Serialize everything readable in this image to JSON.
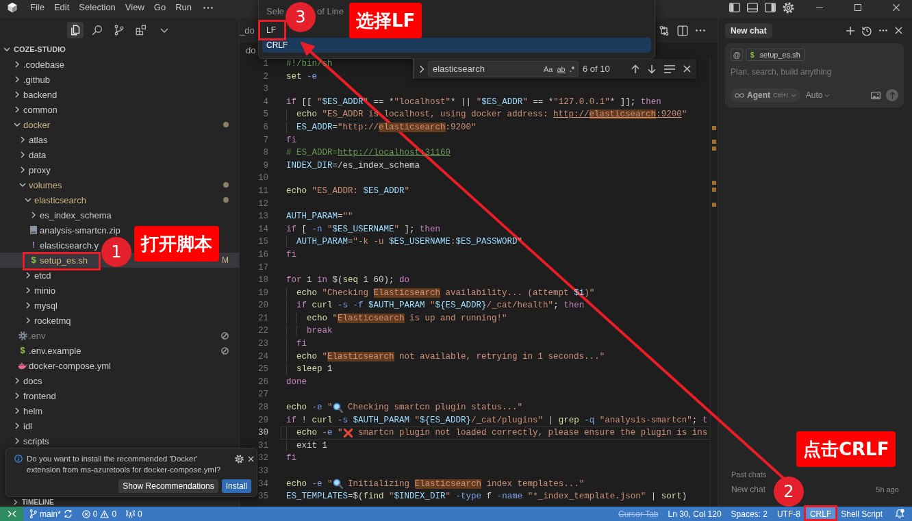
{
  "window": {
    "menu": [
      "File",
      "Edit",
      "Selection",
      "View",
      "Go",
      "Run"
    ]
  },
  "activity_tabs": [
    {
      "selected": true
    },
    {
      "selected": false
    },
    {
      "selected": false
    },
    {
      "selected": false
    }
  ],
  "explorer": {
    "root": {
      "label": "COZE-STUDIO",
      "expanded": true
    },
    "items": [
      {
        "label": ".codebase",
        "kind": "folder",
        "expanded": false,
        "selected": false,
        "modified": false
      },
      {
        "label": ".github",
        "kind": "folder",
        "expanded": false,
        "selected": false,
        "modified": false
      },
      {
        "label": "backend",
        "kind": "folder",
        "expanded": false,
        "selected": false,
        "modified": false
      },
      {
        "label": "common",
        "kind": "folder",
        "expanded": false,
        "selected": false,
        "modified": false
      },
      {
        "label": "docker",
        "kind": "folder",
        "expanded": true,
        "selected": false,
        "modified": true,
        "children": [
          {
            "label": "atlas",
            "kind": "folder",
            "expanded": false,
            "selected": false,
            "modified": false
          },
          {
            "label": "data",
            "kind": "folder",
            "expanded": false,
            "selected": false,
            "modified": false
          },
          {
            "label": "proxy",
            "kind": "folder",
            "expanded": false,
            "selected": false,
            "modified": false
          },
          {
            "label": "volumes",
            "kind": "folder",
            "expanded": true,
            "selected": false,
            "modified": true,
            "children": [
              {
                "label": "elasticsearch",
                "kind": "folder",
                "expanded": true,
                "selected": false,
                "modified": true,
                "children": [
                  {
                    "label": "es_index_schema",
                    "kind": "folder",
                    "expanded": false,
                    "selected": false,
                    "modified": false
                  },
                  {
                    "label": "analysis-smartcn.zip",
                    "kind": "archive",
                    "selected": false,
                    "modified": false
                  },
                  {
                    "label": "elasticsearch.y",
                    "kind": "yaml",
                    "glyph": "!",
                    "selected": false,
                    "modified": false
                  },
                  {
                    "label": "setup_es.sh",
                    "kind": "shell",
                    "glyph": "$",
                    "selected": true,
                    "modified": true,
                    "badge": "M"
                  }
                ]
              },
              {
                "label": "etcd",
                "kind": "folder",
                "expanded": false,
                "selected": false,
                "modified": false
              },
              {
                "label": "minio",
                "kind": "folder",
                "expanded": false,
                "selected": false,
                "modified": false
              },
              {
                "label": "mysql",
                "kind": "folder",
                "expanded": false,
                "selected": false,
                "modified": false
              },
              {
                "label": "rocketmq",
                "kind": "folder",
                "expanded": false,
                "selected": false,
                "modified": false
              }
            ]
          },
          {
            "label": ".env",
            "kind": "settings",
            "selected": false,
            "modified": false,
            "dimmed": true,
            "blocked": true
          },
          {
            "label": ".env.example",
            "kind": "shell",
            "glyph": "$",
            "selected": false,
            "modified": false,
            "blocked": true
          },
          {
            "label": "docker-compose.yml",
            "kind": "docker",
            "selected": false,
            "modified": false
          }
        ]
      },
      {
        "label": "docs",
        "kind": "folder",
        "expanded": false,
        "selected": false,
        "modified": false
      },
      {
        "label": "frontend",
        "kind": "folder",
        "expanded": false,
        "selected": false,
        "modified": false
      },
      {
        "label": "helm",
        "kind": "folder",
        "expanded": false,
        "selected": false,
        "modified": false
      },
      {
        "label": "idl",
        "kind": "folder",
        "expanded": false,
        "selected": false,
        "modified": false
      },
      {
        "label": "scripts",
        "kind": "folder",
        "expanded": false,
        "selected": false,
        "modified": false
      }
    ]
  },
  "timeline": {
    "label": "TIMELINE",
    "expanded": false
  },
  "editor": {
    "tab": "_do",
    "breadcrumb": "do",
    "lines": [
      {
        "number": "1",
        "current": false,
        "segments": [
          {
            "text": "#!/bin/sh",
            "kind": "com"
          }
        ]
      },
      {
        "number": "2",
        "current": false,
        "segments": [
          {
            "text": "set",
            "kind": "fn"
          },
          {
            "text": " -e",
            "kind": "flag"
          }
        ]
      },
      {
        "number": "3",
        "current": false
      },
      {
        "number": "4",
        "current": false,
        "segments": [
          {
            "text": "if",
            "kind": "kw"
          },
          {
            "text": " [[ ",
            "kind": "plain"
          },
          {
            "text": "\"",
            "kind": "str"
          },
          {
            "text": "$ES_ADDR",
            "kind": "var"
          },
          {
            "text": "\"",
            "kind": "str"
          },
          {
            "text": " == *",
            "kind": "plain"
          },
          {
            "text": "\"localhost\"",
            "kind": "str"
          },
          {
            "text": "* || ",
            "kind": "plain"
          },
          {
            "text": "\"",
            "kind": "str"
          },
          {
            "text": "$ES_ADDR",
            "kind": "var"
          },
          {
            "text": "\"",
            "kind": "str"
          },
          {
            "text": " == *",
            "kind": "plain"
          },
          {
            "text": "\"127.0.0.1\"",
            "kind": "str"
          },
          {
            "text": "* ]]; ",
            "kind": "plain"
          },
          {
            "text": "then",
            "kind": "kw"
          }
        ]
      },
      {
        "number": "5",
        "current": false,
        "segments": [
          {
            "text": "  echo",
            "kind": "fn"
          },
          {
            "text": " \"ES_ADDR is localhost, using docker address: ",
            "kind": "str"
          },
          {
            "text": "http://",
            "kind": "link"
          },
          {
            "text": "elasticsearch",
            "kind": "match-link"
          },
          {
            "text": ":9200",
            "kind": "link"
          },
          {
            "text": "\"",
            "kind": "str"
          }
        ]
      },
      {
        "number": "6",
        "current": false,
        "segments": [
          {
            "text": "  ES_ADDR",
            "kind": "var"
          },
          {
            "text": "=",
            "kind": "plain"
          },
          {
            "text": "\"http://",
            "kind": "str"
          },
          {
            "text": "elasticsearch",
            "kind": "match"
          },
          {
            "text": ":9200\"",
            "kind": "str"
          }
        ]
      },
      {
        "number": "7",
        "current": false,
        "segments": [
          {
            "text": "fi",
            "kind": "kw"
          }
        ]
      },
      {
        "number": "8",
        "current": false,
        "segments": [
          {
            "text": "# ES_ADDR=",
            "kind": "com"
          },
          {
            "text": "http://localhost:31160",
            "kind": "com-link"
          }
        ]
      },
      {
        "number": "9",
        "current": false,
        "segments": [
          {
            "text": "INDEX_DIR",
            "kind": "var"
          },
          {
            "text": "=/es_index_schema",
            "kind": "plain"
          }
        ]
      },
      {
        "number": "10",
        "current": false
      },
      {
        "number": "11",
        "current": false,
        "segments": [
          {
            "text": "echo",
            "kind": "fn"
          },
          {
            "text": " \"ES_ADDR: ",
            "kind": "str"
          },
          {
            "text": "$ES_ADDR",
            "kind": "var"
          },
          {
            "text": "\"",
            "kind": "str"
          }
        ]
      },
      {
        "number": "12",
        "current": false
      },
      {
        "number": "13",
        "current": false,
        "segments": [
          {
            "text": "AUTH_PARAM",
            "kind": "var"
          },
          {
            "text": "=",
            "kind": "plain"
          },
          {
            "text": "\"\"",
            "kind": "str"
          }
        ]
      },
      {
        "number": "14",
        "current": false,
        "segments": [
          {
            "text": "if",
            "kind": "kw"
          },
          {
            "text": " [ ",
            "kind": "plain"
          },
          {
            "text": "-n",
            "kind": "flag"
          },
          {
            "text": " \"",
            "kind": "str"
          },
          {
            "text": "$ES_USERNAME",
            "kind": "var"
          },
          {
            "text": "\"",
            "kind": "str"
          },
          {
            "text": " ]; ",
            "kind": "plain"
          },
          {
            "text": "then",
            "kind": "kw"
          }
        ]
      },
      {
        "number": "15",
        "current": false,
        "segments": [
          {
            "text": "  AUTH_PARAM",
            "kind": "var"
          },
          {
            "text": "=",
            "kind": "plain"
          },
          {
            "text": "\"-k -u ",
            "kind": "str"
          },
          {
            "text": "$ES_USERNAME",
            "kind": "var"
          },
          {
            "text": ":",
            "kind": "str"
          },
          {
            "text": "$ES_PASSWORD",
            "kind": "var"
          },
          {
            "text": "\"",
            "kind": "str"
          }
        ]
      },
      {
        "number": "16",
        "current": false,
        "segments": [
          {
            "text": "fi",
            "kind": "kw"
          }
        ]
      },
      {
        "number": "17",
        "current": false
      },
      {
        "number": "18",
        "current": false,
        "segments": [
          {
            "text": "for",
            "kind": "kw"
          },
          {
            "text": " i ",
            "kind": "plain"
          },
          {
            "text": "in",
            "kind": "kw"
          },
          {
            "text": " $(",
            "kind": "plain"
          },
          {
            "text": "seq",
            "kind": "fn"
          },
          {
            "text": " 1 60); ",
            "kind": "plain"
          },
          {
            "text": "do",
            "kind": "kw"
          }
        ]
      },
      {
        "number": "19",
        "current": false,
        "segments": [
          {
            "text": "  echo",
            "kind": "fn"
          },
          {
            "text": " \"Checking ",
            "kind": "str"
          },
          {
            "text": "Elasticsearch",
            "kind": "match"
          },
          {
            "text": " availability... (attempt ",
            "kind": "str"
          },
          {
            "text": "$i",
            "kind": "var"
          },
          {
            "text": ")\"",
            "kind": "str"
          }
        ]
      },
      {
        "number": "20",
        "current": false,
        "segments": [
          {
            "text": "  if",
            "kind": "kw"
          },
          {
            "text": " curl",
            "kind": "fn"
          },
          {
            "text": " -s -f ",
            "kind": "flag"
          },
          {
            "text": "$AUTH_PARAM",
            "kind": "var"
          },
          {
            "text": " \"",
            "kind": "str"
          },
          {
            "text": "${ES_ADDR}",
            "kind": "var"
          },
          {
            "text": "/_cat/health\"",
            "kind": "str"
          },
          {
            "text": "; ",
            "kind": "plain"
          },
          {
            "text": "then",
            "kind": "kw"
          }
        ]
      },
      {
        "number": "21",
        "current": false,
        "segments": [
          {
            "text": "    echo",
            "kind": "fn"
          },
          {
            "text": " \"",
            "kind": "str"
          },
          {
            "text": "Elasticsearch",
            "kind": "match"
          },
          {
            "text": " is up and running!\"",
            "kind": "str"
          }
        ]
      },
      {
        "number": "22",
        "current": false,
        "segments": [
          {
            "text": "    break",
            "kind": "kw"
          }
        ]
      },
      {
        "number": "23",
        "current": false,
        "segments": [
          {
            "text": "  fi",
            "kind": "kw"
          }
        ]
      },
      {
        "number": "24",
        "current": false,
        "segments": [
          {
            "text": "  echo",
            "kind": "fn"
          },
          {
            "text": " \"",
            "kind": "str"
          },
          {
            "text": "Elasticsearch",
            "kind": "match"
          },
          {
            "text": " not available, retrying in 1 seconds...\"",
            "kind": "str"
          }
        ]
      },
      {
        "number": "25",
        "current": false,
        "segments": [
          {
            "text": "  sleep",
            "kind": "fn"
          },
          {
            "text": " 1",
            "kind": "plain"
          }
        ]
      },
      {
        "number": "26",
        "current": false,
        "segments": [
          {
            "text": "done",
            "kind": "kw"
          }
        ]
      },
      {
        "number": "27",
        "current": false
      },
      {
        "number": "28",
        "current": false,
        "segments": [
          {
            "text": "echo",
            "kind": "fn"
          },
          {
            "text": " -e",
            "kind": "flag"
          },
          {
            "text": " \"",
            "kind": "str"
          },
          {
            "kind": "emoji-search"
          },
          {
            "text": " Checking smartcn plugin status...\"",
            "kind": "str"
          }
        ]
      },
      {
        "number": "29",
        "current": false,
        "segments": [
          {
            "text": "if",
            "kind": "kw"
          },
          {
            "text": " ! ",
            "kind": "plain"
          },
          {
            "text": "curl",
            "kind": "fn"
          },
          {
            "text": " -s ",
            "kind": "flag"
          },
          {
            "text": "$AUTH_PARAM",
            "kind": "var"
          },
          {
            "text": " \"",
            "kind": "str"
          },
          {
            "text": "${ES_ADDR}",
            "kind": "var"
          },
          {
            "text": "/_cat/plugins\"",
            "kind": "str"
          },
          {
            "text": " | ",
            "kind": "plain"
          },
          {
            "text": "grep",
            "kind": "fn"
          },
          {
            "text": " -q ",
            "kind": "flag"
          },
          {
            "text": "\"analysis-smartcn\"",
            "kind": "str"
          },
          {
            "text": "; ",
            "kind": "plain"
          },
          {
            "text": "t",
            "kind": "kw"
          }
        ]
      },
      {
        "number": "30",
        "current": true,
        "segments": [
          {
            "text": "  echo",
            "kind": "fn"
          },
          {
            "text": " -e",
            "kind": "flag"
          },
          {
            "text": " \"",
            "kind": "str"
          },
          {
            "kind": "emoji-cross"
          },
          {
            "text": " smartcn plugin not loaded correctly, please ensure the plugin is ins",
            "kind": "str"
          }
        ]
      },
      {
        "number": "31",
        "current": false,
        "segments": [
          {
            "text": "  exit 1",
            "kind": "plain"
          }
        ]
      },
      {
        "number": "32",
        "current": false,
        "segments": [
          {
            "text": "fi",
            "kind": "kw"
          }
        ]
      },
      {
        "number": "33",
        "current": false
      },
      {
        "number": "34",
        "current": false,
        "segments": [
          {
            "text": "echo",
            "kind": "fn"
          },
          {
            "text": " -e",
            "kind": "flag"
          },
          {
            "text": " \"",
            "kind": "str"
          },
          {
            "kind": "emoji-search"
          },
          {
            "text": " Initializing ",
            "kind": "str"
          },
          {
            "text": "Elasticsearch",
            "kind": "match"
          },
          {
            "text": " index templates...\"",
            "kind": "str"
          }
        ]
      },
      {
        "number": "35",
        "current": false,
        "segments": [
          {
            "text": "ES_TEMPLATES",
            "kind": "var"
          },
          {
            "text": "=$(",
            "kind": "plain"
          },
          {
            "text": "find",
            "kind": "fn"
          },
          {
            "text": " \"",
            "kind": "str"
          },
          {
            "text": "$INDEX_DIR",
            "kind": "var"
          },
          {
            "text": "\"",
            "kind": "str"
          },
          {
            "text": " -type",
            "kind": "flag"
          },
          {
            "text": " f ",
            "kind": "plain"
          },
          {
            "text": "-name",
            "kind": "flag"
          },
          {
            "text": " \"*_index_template.json\"",
            "kind": "str"
          },
          {
            "text": " | ",
            "kind": "plain"
          },
          {
            "text": "sort",
            "kind": "fn"
          },
          {
            "text": ")",
            "kind": "plain"
          }
        ]
      }
    ]
  },
  "find": {
    "query": "elasticsearch",
    "toggles": [
      {
        "label": "Aa",
        "kind": "case"
      },
      {
        "label": "ab",
        "kind": "word"
      },
      {
        "label": ".*",
        "kind": "regex"
      }
    ],
    "count": "6 of 10"
  },
  "quick_pick": {
    "prompt_parts": [
      "Sele",
      "of Line"
    ],
    "items": [
      {
        "label": "LF",
        "selected": false
      },
      {
        "label": "CRLF",
        "selected": true
      }
    ]
  },
  "notification": {
    "message": "Do you want to install the recommended 'Docker' extension from ms-azuretools for docker-compose.yml?",
    "buttons": [
      {
        "label": "Show Recommendations",
        "primary": false
      },
      {
        "label": "Install",
        "primary": true
      }
    ]
  },
  "chat": {
    "tab": "New chat",
    "mention": "@",
    "context_file": {
      "glyph": "$",
      "label": "setup_es.sh"
    },
    "placeholder": "Plan, search, build anything",
    "mode": {
      "label": "Agent",
      "shortcut": "Ctrl+I"
    },
    "model": "Auto",
    "history_title": "Past chats",
    "history": [
      {
        "title": "New chat",
        "time": "5h ago"
      }
    ]
  },
  "status_bar": {
    "branch": "main*",
    "errors": "0",
    "warnings": "0",
    "ports": "0",
    "items": [
      {
        "text": "Cursor Tab",
        "disabled": true,
        "active": false
      },
      {
        "text": "Ln 30, Col 120",
        "disabled": false,
        "active": false
      },
      {
        "text": "Spaces: 2",
        "disabled": false,
        "active": false
      },
      {
        "text": "UTF-8",
        "disabled": false,
        "active": false
      },
      {
        "text": "CRLF",
        "disabled": false,
        "active": true
      },
      {
        "text": "Shell Script",
        "disabled": false,
        "active": false
      }
    ],
    "unread_notifications": true
  },
  "annotations": [
    {
      "number": "1",
      "label": "打开脚本"
    },
    {
      "number": "2",
      "label": "点击CRLF"
    },
    {
      "number": "3",
      "label": "选择LF"
    }
  ]
}
